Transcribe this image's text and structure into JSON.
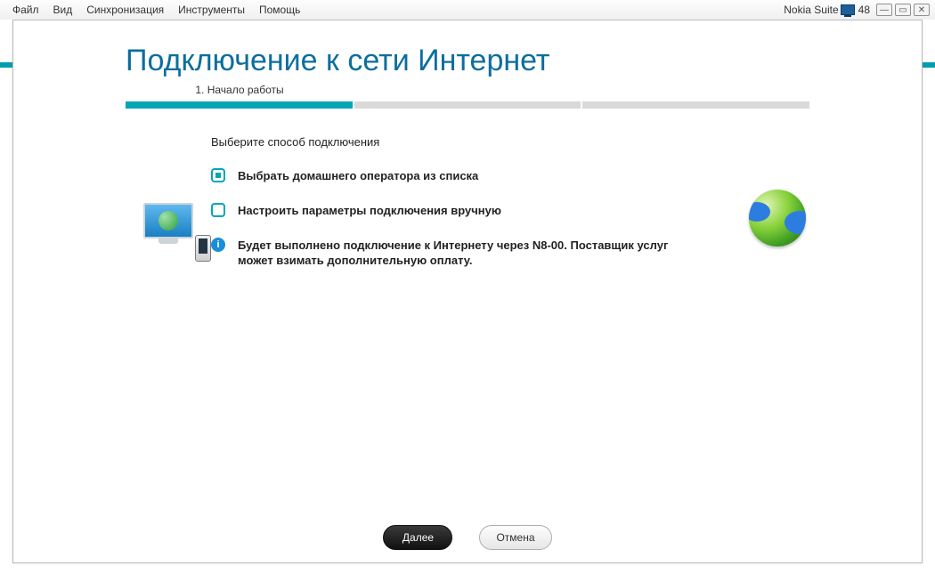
{
  "menu": {
    "file": "Файл",
    "view": "Вид",
    "sync": "Синхронизация",
    "tools": "Инструменты",
    "help": "Помощь"
  },
  "window": {
    "title": "Nokia Suite",
    "indicator_number": "48"
  },
  "wizard": {
    "title": "Подключение к сети Интернет",
    "step_label": "1. Начало работы",
    "prompt": "Выберите способ подключения",
    "option1": "Выбрать домашнего оператора из списка",
    "option2": "Настроить параметры подключения вручную",
    "info": "Будет выполнено подключение к Интернету через N8-00. Поставщик услуг может взимать дополнительную оплату."
  },
  "buttons": {
    "next": "Далее",
    "cancel": "Отмена"
  }
}
